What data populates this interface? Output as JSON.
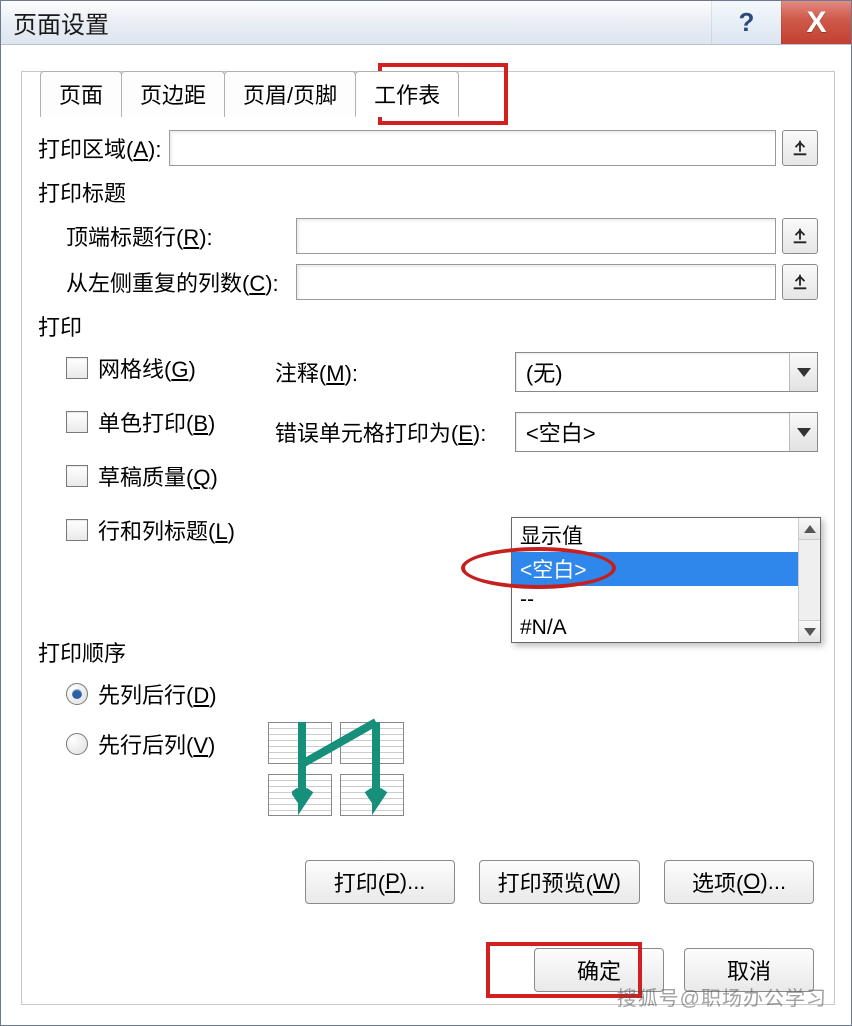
{
  "title": "页面设置",
  "tabs": {
    "page": "页面",
    "margins": "页边距",
    "header_footer": "页眉/页脚",
    "worksheet": "工作表"
  },
  "print_area": {
    "label_pre": "打印区域(",
    "hotkey": "A",
    "label_suf": "):"
  },
  "titles": {
    "section": "打印标题",
    "top_rows_pre": "顶端标题行(",
    "top_rows_key": "R",
    "top_rows_suf": "):",
    "left_cols_pre": "从左侧重复的列数(",
    "left_cols_key": "C",
    "left_cols_suf": "):"
  },
  "print_section": {
    "label": "打印",
    "checks": {
      "grid_pre": "网格线(",
      "grid_key": "G",
      "grid_suf": ")",
      "bw_pre": "单色打印(",
      "bw_key": "B",
      "bw_suf": ")",
      "draft_pre": "草稿质量(",
      "draft_key": "Q",
      "draft_suf": ")",
      "rch_pre": "行和列标题(",
      "rch_key": "L",
      "rch_suf": ")"
    },
    "comments_label_pre": "注释(",
    "comments_key": "M",
    "comments_suf": "):",
    "comments_value": "(无)",
    "errors_label_pre": "错误单元格打印为(",
    "errors_key": "E",
    "errors_suf": "):",
    "errors_value": "<空白>",
    "errors_options": [
      "显示值",
      "<空白>",
      "--",
      "#N/A"
    ]
  },
  "order": {
    "label": "打印顺序",
    "down_pre": "先列后行(",
    "down_key": "D",
    "down_suf": ")",
    "over_pre": "先行后列(",
    "over_key": "V",
    "over_suf": ")"
  },
  "buttons": {
    "print_pre": "打印(",
    "print_key": "P",
    "print_suf": ")...",
    "preview_pre": "打印预览(",
    "preview_key": "W",
    "preview_suf": ")",
    "options_pre": "选项(",
    "options_key": "O",
    "options_suf": ")..."
  },
  "ok": "确定",
  "cancel": "取消",
  "watermark": "搜狐号@职场办公学习"
}
